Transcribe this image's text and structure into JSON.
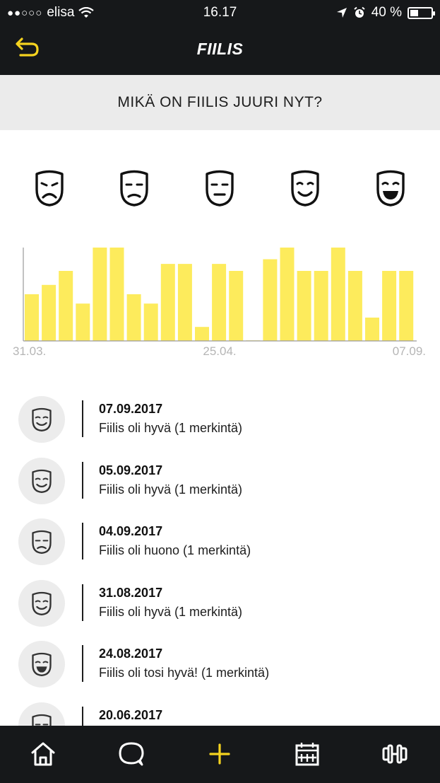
{
  "status": {
    "carrier": "elisa",
    "signal": "●●○○○",
    "time": "16.17",
    "battery": "40 %",
    "battery_level": 0.4
  },
  "header": {
    "title": "FIILIS"
  },
  "question": "MIKÄ ON FIILIS JUURI NYT?",
  "moods": [
    "very-bad-mood-icon",
    "bad-mood-icon",
    "neutral-mood-icon",
    "good-mood-icon",
    "very-good-mood-icon"
  ],
  "chart_data": {
    "type": "bar",
    "categories": [
      "31.03.",
      "",
      "",
      "",
      "",
      "",
      "",
      "",
      "",
      "",
      "",
      "25.04.",
      "",
      "",
      "",
      "",
      "",
      "",
      "",
      "",
      "",
      "",
      "07.09."
    ],
    "values": [
      2,
      2.4,
      3,
      1.6,
      4,
      4,
      2,
      1.6,
      3.3,
      3.3,
      0.6,
      3.3,
      3,
      0,
      3.5,
      4,
      3,
      3,
      4,
      3,
      1,
      3,
      3
    ],
    "ylim": [
      0,
      4
    ],
    "tick_labels": [
      "31.03.",
      "25.04.",
      "07.09."
    ],
    "bar_color": "#fdeb5c"
  },
  "entries": [
    {
      "date": "07.09.2017",
      "text": "Fiilis oli hyvä (1 merkintä)",
      "mood": "good-mood-icon"
    },
    {
      "date": "05.09.2017",
      "text": "Fiilis oli hyvä (1 merkintä)",
      "mood": "good-mood-icon"
    },
    {
      "date": "04.09.2017",
      "text": "Fiilis oli huono (1 merkintä)",
      "mood": "bad-mood-icon"
    },
    {
      "date": "31.08.2017",
      "text": "Fiilis oli hyvä (1 merkintä)",
      "mood": "good-mood-icon"
    },
    {
      "date": "24.08.2017",
      "text": "Fiilis oli tosi hyvä! (1 merkintä)",
      "mood": "very-good-mood-icon"
    },
    {
      "date": "20.06.2017",
      "text": "",
      "mood": "neutral-mood-icon"
    }
  ],
  "nav": [
    "home-icon",
    "chat-icon",
    "add-icon",
    "calendar-icon",
    "dumbbell-icon"
  ],
  "colors": {
    "accent": "#f5d31f",
    "dark": "#16181a",
    "bar": "#fdeb5c"
  }
}
